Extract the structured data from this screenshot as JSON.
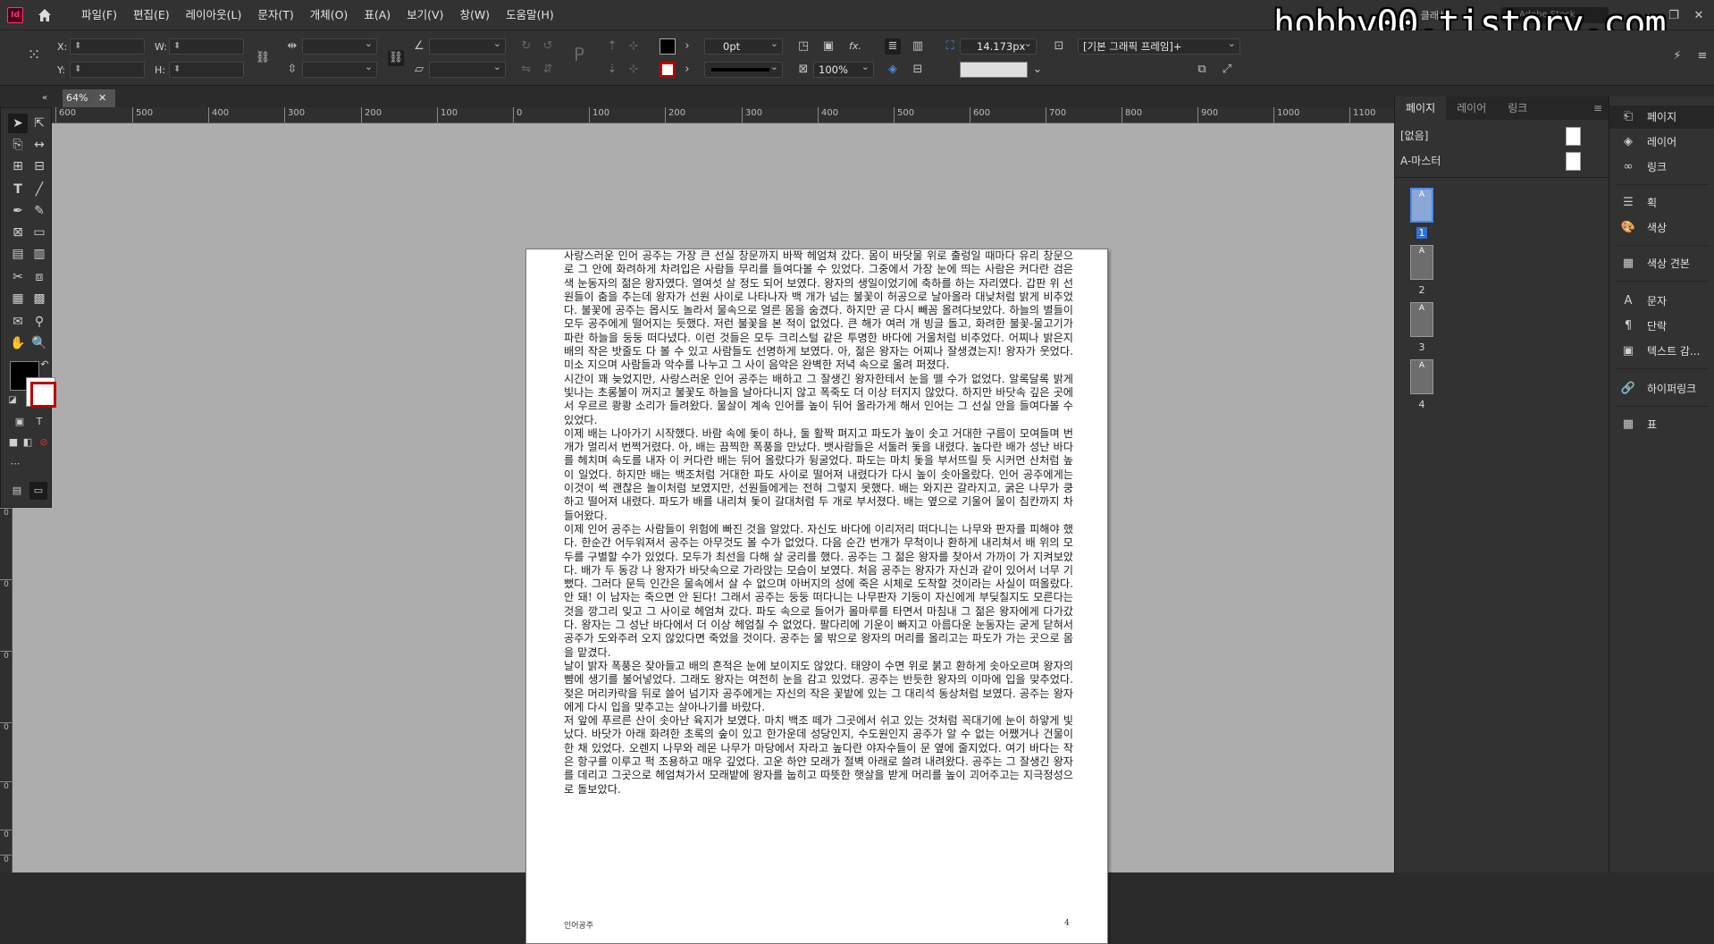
{
  "app": {
    "badge": "Id"
  },
  "menu": [
    "파일(F)",
    "편집(E)",
    "레이아웃(L)",
    "문자(T)",
    "개체(O)",
    "표(A)",
    "보기(V)",
    "창(W)",
    "도움말(H)"
  ],
  "header": {
    "workspace": "필수 클래식",
    "stock_search": "Adobe Stock",
    "watermark": "hobby00.tistory.com"
  },
  "control": {
    "x_label": "X:",
    "y_label": "Y:",
    "w_label": "W:",
    "h_label": "H:",
    "stroke_weight": "0pt",
    "opacity": "100%",
    "fx": "fx.",
    "corner_size": "14.173px",
    "frame_style": "[기본 그래픽 프레임]+"
  },
  "document": {
    "zoom_tab": "64%"
  },
  "ruler": {
    "h_ticks": [
      "600",
      "500",
      "400",
      "300",
      "200",
      "100",
      "0",
      "100",
      "200",
      "300",
      "400",
      "500",
      "600",
      "700",
      "800",
      "900",
      "1000",
      "1100"
    ],
    "v_ticks": [
      "0",
      "0",
      "0",
      "0",
      "0",
      "0",
      "0",
      "1",
      "1"
    ]
  },
  "page_text": [
    "사랑스러운 인어 공주는 가장 큰 선실 창문까지 바짝 헤엄쳐 갔다. 몸이 바닷물 위로 출렁일 때마다 유리 창문으로 그 안에 화려하게 차려입은 사람들 무리를 들여다볼 수 있었다. 그중에서 가장 눈에 띄는 사람은 커다란 검은색 눈동자의 젊은 왕자였다. 열여섯 살 정도 되어 보였다. 왕자의 생일이었기에 축하를 하는 자리였다. 갑판 위 선원들이 춤을 추는데 왕자가 선원 사이로 나타나자 백 개가 넘는 불꽃이 허공으로 날아올라 대낮처럼 밝게 비추었다. 불꽃에 공주는 몹시도 놀라서 물속으로 얼른 몸을 숨겼다. 하지만 곧 다시 빼꼼 올려다보았다. 하늘의 별들이 모두 공주에게 떨어지는 듯했다. 저런 불꽃을 본 적이 없었다. 큰 해가 여러 개 빙글 돌고, 화려한 불꽃-물고기가 파란 하늘을 둥둥 떠다녔다. 이런 것들은 모두 크리스털 같은 투명한 바다에 거울처럼 비추었다. 어찌나 밝은지 배의 작은 밧줄도 다 볼 수 있고 사람들도 선명하게 보였다. 아, 젊은 왕자는 어찌나 잘생겼는지! 왕자가 웃었다. 미소 지으며 사람들과 악수를 나누고 그 사이 음악은 완벽한 저녁 속으로 울려 퍼졌다.",
    "시간이 꽤 늦었지만, 사랑스러운 인어 공주는 배하고 그 잘생긴 왕자한테서 눈을 뗄 수가 없었다. 알록달록 밝게 빛나는 초롱불이 꺼지고 불꽃도 하늘을 날아다니지 않고 폭죽도 더 이상 터지지 않았다. 하지만 바닷속 깊은 곳에서 우르르 쾅쾅 소리가 들려왔다. 물살이 계속 인어를 높이 뒤어 올라가게 해서 인어는 그 선실 안을 들여다볼 수 있었다.",
    "이제 배는 나아가기 시작했다. 바람 속에 돛이 하나, 둘 활짝 펴지고 파도가 높이 솟고 거대한 구름이 모여들며 번개가 멀리서 번쩍거렸다. 아, 배는 끔찍한 폭풍을 만났다. 뱃사람들은 서둘러 돛을 내렸다. 높다란 배가 성난 바다를 헤치며 속도를 내자 이 커다란 배는 뒤어 올랐다가 뒹굴었다. 파도는 마치 돛을 부서뜨릴 듯 시커먼 산처럼 높이 일었다. 하지만 배는 백조처럼 거대한 파도 사이로 떨어져 내렸다가 다시 높이 솟아올랐다. 인어 공주에게는 이것이 썩 괜찮은 놀이처럼 보였지만, 선원들에게는 전혀 그렇지 못했다. 배는 와지끈 갈라지고, 굵은 나무가 쿵 하고 떨어져 내렸다. 파도가 배를 내리쳐 돛이 갈대처럼 두 개로 부서졌다. 배는 옆으로 기울어 물이 침칸까지 차들어왔다.",
    "이제 인어 공주는 사람들이 위험에 빠진 것을 알았다. 자신도 바다에 이리저리 떠다니는 나무와 판자를 피해야 했다. 한순간 어두워져서 공주는 아무것도 볼 수가 없었다. 다음 순간 번개가 무척이나 환하게 내리쳐서 배 위의 모두를 구별할 수가 있었다. 모두가 최선을 다해 살 궁리를 했다. 공주는 그 젊은 왕자를 찾아서 가까이 가 지켜보았다. 배가 두 동강 나 왕자가 바닷속으로 가라앉는 모습이 보였다. 처음 공주는 왕자가 자신과 같이 있어서 너무 기뻤다. 그러다 문득 인간은 물속에서 살 수 없으며 아버지의 성에 죽은 시체로 도착할 것이라는 사실이 떠올랐다. 안 돼! 이 남자는 죽으면 안 된다! 그래서 공주는 둥둥 떠다니는 나무판자 기둥이 자신에게 부딪칠지도 모른다는 것을 깡그리 잊고 그 사이로 헤엄쳐 갔다. 파도 속으로 들어가 몰마루를 타면서 마침내 그 젊은 왕자에게 다가갔다. 왕자는 그 성난 바다에서 더 이상 헤엄칠 수 없었다. 팔다리에 기운이 빠지고 아름다운 눈동자는 굳게 닫혀서 공주가 도와주러 오지 않았다면 죽었을 것이다. 공주는 물 밖으로 왕자의 머리를 올리고는 파도가 가는 곳으로 몸을 맡겼다.",
    "날이 밝자 폭풍은 잦아들고 배의 흔적은 눈에 보이지도 않았다. 태양이 수면 위로 붉고 환하게 솟아오르며 왕자의 뺨에 생기를 불어넣었다. 그래도 왕자는 여전히 눈을 감고 있었다. 공주는 반듯한 왕자의 이마에 입을 맞추었다. 젖은 머리카락을 뒤로 쓸어 넘기자 공주에게는 자신의 작은 꽃밭에 있는 그 대리석 동상처럼 보였다. 공주는 왕자에게 다시 입을 맞추고는 살아나기를 바랐다.",
    "저 앞에 푸르른 산이 솟아난 육지가 보였다. 마치 백조 떼가 그곳에서 쉬고 있는 것처럼 꼭대기에 눈이 하얗게 빛났다. 바닷가 아래 화려한 초록의 숲이 있고 한가운데 성당인지, 수도원인지 공주가 알 수 없는 어쨌거나 건물이 한 채 있었다. 오렌지 나무와 레몬 나무가 마당에서 자라고 높다란 야자수들이 문 옆에 줄지었다. 여기 바다는 작은 항구를 이루고 퍽 조용하고 매우 깊었다. 고운 하얀 모래가 절벽 아래로 쓸려 내려왔다. 공주는 그 잘생긴 왕자를 데리고 그곳으로 헤엄쳐가서 모래밭에 왕자를 눕히고 따뜻한 햇살을 받게 머리를 높이 괴어주고는 지극정성으로 돌보았다."
  ],
  "page_footer": {
    "left": "인어공주",
    "right": "4"
  },
  "pages_panel": {
    "tabs": [
      "페이지",
      "레이어",
      "링크"
    ],
    "masters": [
      "[없음]",
      "A-마스터"
    ],
    "pages": [
      {
        "num": "1",
        "master": "A"
      },
      {
        "num": "2",
        "master": "A"
      },
      {
        "num": "3",
        "master": "A"
      },
      {
        "num": "4",
        "master": "A"
      }
    ]
  },
  "side_panel": {
    "items": [
      {
        "label": "페이지",
        "icon": "pages-icon"
      },
      {
        "label": "레이어",
        "icon": "layers-icon"
      },
      {
        "label": "링크",
        "icon": "links-icon"
      },
      {
        "label": "획",
        "icon": "stroke-icon"
      },
      {
        "label": "색상",
        "icon": "color-icon"
      },
      {
        "label": "색상 견본",
        "icon": "swatches-icon"
      },
      {
        "label": "문자",
        "icon": "character-icon"
      },
      {
        "label": "단락",
        "icon": "paragraph-icon"
      },
      {
        "label": "텍스트 감...",
        "icon": "text-wrap-icon"
      },
      {
        "label": "하이퍼링크",
        "icon": "hyperlinks-icon"
      },
      {
        "label": "표",
        "icon": "table-icon"
      }
    ]
  },
  "colors": {
    "background": "#2b2b2b",
    "panel": "#323232",
    "pasteboard": "#adadad",
    "accent": "#2f6fdb",
    "badge": "#ff3366"
  }
}
